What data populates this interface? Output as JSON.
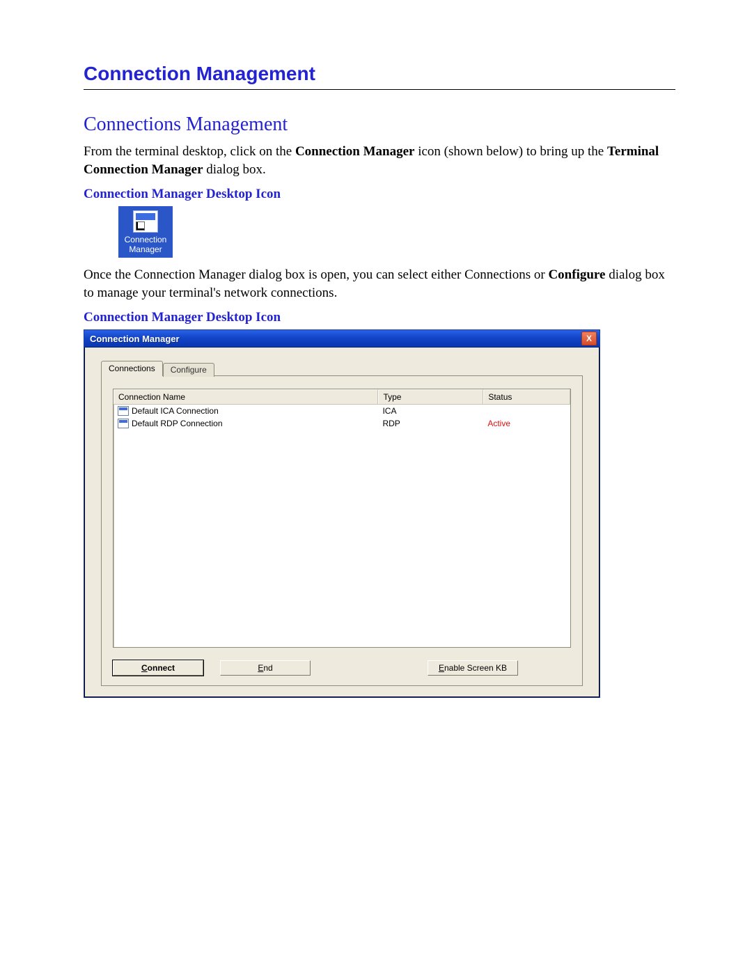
{
  "doc": {
    "chapter_title": "Connection Management",
    "section_title": "Connections Management",
    "para1_pre": "From the terminal desktop, click on the ",
    "para1_bold1": "Connection Manager",
    "para1_mid": " icon (shown below) to bring up the ",
    "para1_bold2": "Terminal Connection Manager",
    "para1_post": " dialog box.",
    "fig1_caption": "Connection Manager Desktop Icon",
    "desktop_icon_line1": "Connection",
    "desktop_icon_line2": "Manager",
    "para2_pre": "Once the Connection Manager dialog box is open, you can select either Connections or ",
    "para2_bold1": "Configure",
    "para2_post": " dialog box to manage your terminal's network connections.",
    "fig2_caption": "Connection Manager Desktop Icon"
  },
  "dialog": {
    "title": "Connection Manager",
    "close_glyph": "X",
    "tabs": {
      "connections": "Connections",
      "configure": "Configure"
    },
    "columns": {
      "name": "Connection Name",
      "type": "Type",
      "status": "Status"
    },
    "rows": [
      {
        "name": "Default ICA Connection",
        "type": "ICA",
        "status": ""
      },
      {
        "name": "Default RDP Connection",
        "type": "RDP",
        "status": "Active",
        "status_active": true
      }
    ],
    "buttons": {
      "connect_u": "C",
      "connect_rest": "onnect",
      "end_u": "E",
      "end_rest": "nd",
      "kb_u": "E",
      "kb_rest": "nable Screen KB"
    }
  }
}
